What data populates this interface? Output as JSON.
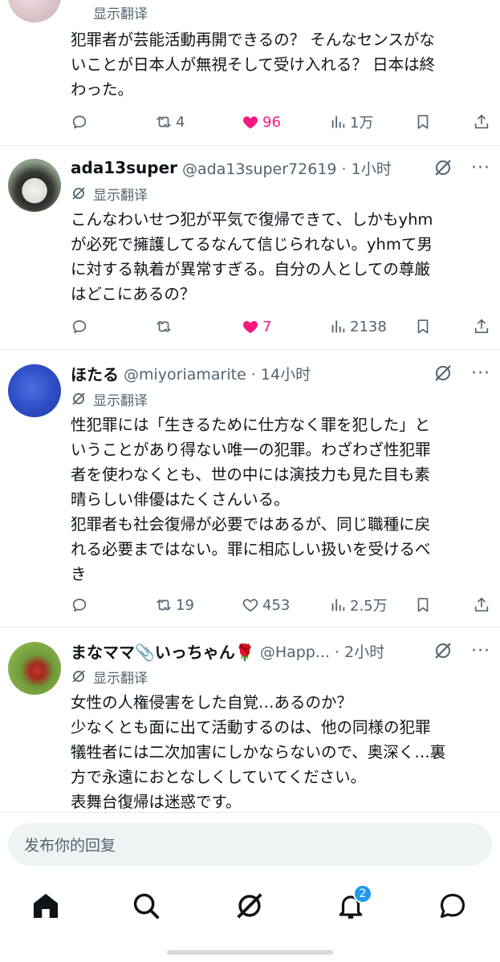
{
  "tweets": [
    {
      "translate_label": "显示翻译",
      "lines": [
        "犯罪者が芸能活動再開できるの？ そんなセンスがな",
        "いことが日本人が無視そして受け入れる？ 日本は終",
        "わった。"
      ],
      "retweets": "4",
      "likes": "96",
      "views": "1万"
    },
    {
      "name": "ada13super",
      "handle": "@ada13super72619 · 1小时",
      "translate_label": "显示翻译",
      "lines": [
        "こんなわいせつ犯が平気で復帰できて、しかもyhm",
        "が必死で擁護してるなんて信じられない。yhmて男",
        "に対する執着が異常すぎる。自分の人としての尊厳",
        "はどこにあるの？"
      ],
      "retweets": "",
      "likes": "7",
      "views": "2138"
    },
    {
      "name": "ほたる",
      "handle": "@miyoriamarite · 14小时",
      "translate_label": "显示翻译",
      "lines": [
        "性犯罪には「生きるために仕方なく罪を犯した」と",
        "いうことがあり得ない唯一の犯罪。わざわざ性犯罪",
        "者を使わなくとも、世の中には演技力も見た目も素",
        "晴らしい俳優はたくさんいる。",
        "犯罪者も社会復帰が必要ではあるが、同じ職種に戻",
        "れる必要まではない。罪に相応しい扱いを受けるべ",
        "き"
      ],
      "retweets": "19",
      "likes": "453",
      "views": "2.5万"
    },
    {
      "name": "まなママ📎いっちゃん🌹",
      "handle": "@Happ... · 2小时",
      "translate_label": "显示翻译",
      "lines": [
        "女性の人権侵害をした自覚…あるのか？",
        "少なくとも面に出て活動するのは、他の同様の犯罪",
        "犠牲者には二次加害にしかならないので、奥深く…裏",
        "方で永遠におとなしくしていてください。",
        "表舞台復帰は迷惑です。"
      ]
    }
  ],
  "reply_input": {
    "placeholder": "发布你的回复"
  },
  "tabbar": {
    "notifications_badge": "2"
  },
  "colors": {
    "like": "#f91880",
    "muted": "#536471",
    "badge": "#1d9bf0"
  },
  "icons": [
    "reply-icon",
    "retweet-icon",
    "heart-icon",
    "views-icon",
    "bookmark-icon",
    "share-icon",
    "grok-icon",
    "more-icon",
    "translate-icon",
    "home-icon",
    "search-icon",
    "notifications-icon",
    "messages-icon"
  ]
}
